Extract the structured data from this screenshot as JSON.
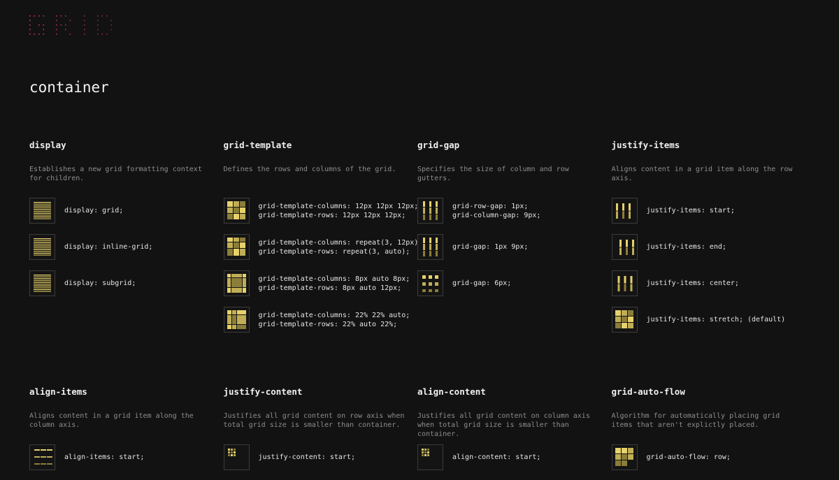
{
  "colors": {
    "background": "#121212",
    "accent_gold": "#e7d16b",
    "accent_dim": "#8b7d3a",
    "logo_pink": "#d6336c"
  },
  "logo": {
    "text": "GRID",
    "icon": "dotted-grid-logo"
  },
  "section": {
    "title": "container"
  },
  "properties": [
    {
      "title": "display",
      "desc": "Establishes a new grid formatting context for children.",
      "examples": [
        {
          "icon": "display-grid-icon",
          "code": "display: grid;"
        },
        {
          "icon": "display-inline-grid-icon",
          "code": "display: inline-grid;"
        },
        {
          "icon": "display-subgrid-icon",
          "code": "display: subgrid;"
        }
      ]
    },
    {
      "title": "grid-template",
      "desc": "Defines the rows and columns of the grid.",
      "examples": [
        {
          "icon": "grid-template-fixed-icon",
          "code": "grid-template-columns: 12px 12px 12px;\ngrid-template-rows: 12px 12px 12px;"
        },
        {
          "icon": "grid-template-repeat-icon",
          "code": "grid-template-columns: repeat(3, 12px);\ngrid-template-rows: repeat(3, auto);"
        },
        {
          "icon": "grid-template-auto-icon",
          "code": "grid-template-columns: 8px auto 8px;\ngrid-template-rows: 8px auto 12px;"
        },
        {
          "icon": "grid-template-percent-icon",
          "code": "grid-template-columns: 22% 22% auto;\ngrid-template-rows: 22% auto 22%;"
        }
      ]
    },
    {
      "title": "grid-gap",
      "desc": "Specifies the size of column and row gutters.",
      "examples": [
        {
          "icon": "grid-gap-separate-icon",
          "code": "grid-row-gap: 1px;\ngrid-column-gap: 9px;"
        },
        {
          "icon": "grid-gap-shorthand-icon",
          "code": "grid-gap: 1px 9px;"
        },
        {
          "icon": "grid-gap-single-icon",
          "code": "grid-gap: 6px;"
        }
      ]
    },
    {
      "title": "justify-items",
      "desc": "Aligns content in a grid item along the row axis.",
      "examples": [
        {
          "icon": "justify-items-start-icon",
          "code": "justify-items: start;"
        },
        {
          "icon": "justify-items-end-icon",
          "code": "justify-items: end;"
        },
        {
          "icon": "justify-items-center-icon",
          "code": "justify-items: center;"
        },
        {
          "icon": "justify-items-stretch-icon",
          "code": "justify-items: stretch; (default)"
        }
      ]
    },
    {
      "title": "align-items",
      "desc": "Aligns content in a grid item along the column axis.",
      "examples": [
        {
          "icon": "align-items-start-icon",
          "code": "align-items: start;"
        }
      ]
    },
    {
      "title": "justify-content",
      "desc": "Justifies all grid content on row axis when total grid size is smaller than container.",
      "examples": [
        {
          "icon": "justify-content-start-icon",
          "code": "justify-content: start;"
        }
      ]
    },
    {
      "title": "align-content",
      "desc": "Justifies all grid content on column axis when total grid size is smaller than container.",
      "examples": [
        {
          "icon": "align-content-start-icon",
          "code": "align-content: start;"
        }
      ]
    },
    {
      "title": "grid-auto-flow",
      "desc": "Algorithm for automatically placing grid items that aren't explictly placed.",
      "examples": [
        {
          "icon": "grid-auto-flow-row-icon",
          "code": "grid-auto-flow: row;"
        }
      ]
    }
  ]
}
